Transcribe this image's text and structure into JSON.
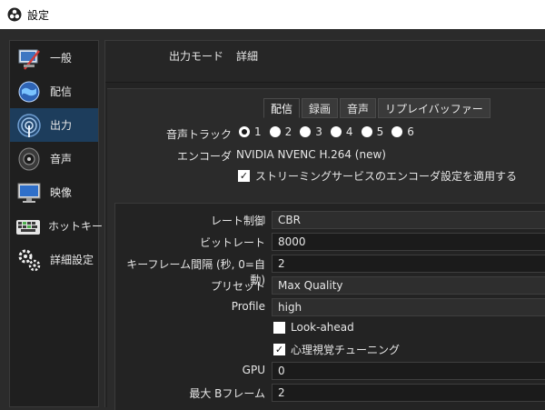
{
  "window": {
    "title": "設定"
  },
  "sidebar": {
    "items": [
      {
        "label": "一般",
        "icon": "general-icon"
      },
      {
        "label": "配信",
        "icon": "stream-icon"
      },
      {
        "label": "出力",
        "icon": "output-icon",
        "active": true
      },
      {
        "label": "音声",
        "icon": "audio-icon"
      },
      {
        "label": "映像",
        "icon": "video-icon"
      },
      {
        "label": "ホットキー",
        "icon": "hotkey-icon"
      },
      {
        "label": "詳細設定",
        "icon": "advanced-icon"
      }
    ]
  },
  "output": {
    "mode_label": "出力モード",
    "mode_value": "詳細",
    "tabs": [
      "配信",
      "録画",
      "音声",
      "リプレイバッファー"
    ],
    "audio_track_label": "音声トラック",
    "audio_tracks": [
      "1",
      "2",
      "3",
      "4",
      "5",
      "6"
    ],
    "audio_track_selected": "1",
    "encoder_label": "エンコーダ",
    "encoder_value": "NVIDIA NVENC H.264 (new)",
    "apply_service_label": "ストリーミングサービスのエンコーダ設定を適用する",
    "apply_service_checked": true,
    "rate_control_label": "レート制御",
    "rate_control_value": "CBR",
    "bitrate_label": "ビットレート",
    "bitrate_value": "8000",
    "keyframe_label": "キーフレーム間隔 (秒, 0=自動)",
    "keyframe_value": "2",
    "preset_label": "プリセット",
    "preset_value": "Max Quality",
    "profile_label": "Profile",
    "profile_value": "high",
    "lookahead_label": "Look-ahead",
    "lookahead_checked": false,
    "psycho_label": "心理視覚チューニング",
    "psycho_checked": true,
    "gpu_label": "GPU",
    "gpu_value": "0",
    "bframes_label": "最大 Bフレーム",
    "bframes_value": "2"
  },
  "colors": {
    "active_sidebar": "#1d3d5c",
    "background": "#2b2b2b"
  }
}
